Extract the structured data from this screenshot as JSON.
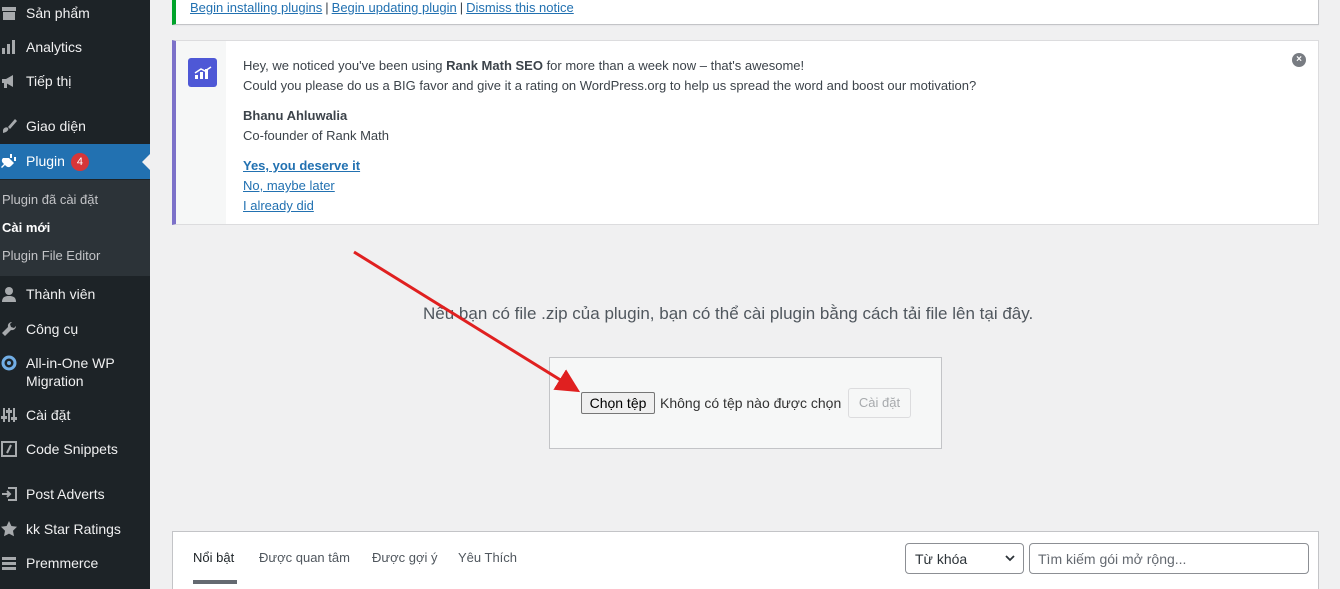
{
  "sidebar": {
    "items": [
      {
        "label": "Sản phẩm",
        "icon": "archive-icon"
      },
      {
        "label": "Analytics",
        "icon": "chart-bar-icon"
      },
      {
        "label": "Tiếp thị",
        "icon": "megaphone-icon"
      },
      {
        "label": "Giao diện",
        "icon": "paintbrush-icon"
      },
      {
        "label": "Plugin",
        "icon": "plug-icon",
        "badge": "4"
      },
      {
        "label": "Thành viên",
        "icon": "user-icon"
      },
      {
        "label": "Công cụ",
        "icon": "wrench-icon"
      },
      {
        "label": "All-in-One WP",
        "label2": "Migration",
        "icon": "migration-icon"
      },
      {
        "label": "Cài đặt",
        "icon": "settings-sliders-icon"
      },
      {
        "label": "Code Snippets",
        "icon": "code-icon"
      },
      {
        "label": "Post Adverts",
        "icon": "signin-icon"
      },
      {
        "label": "kk Star Ratings",
        "icon": "star-icon"
      },
      {
        "label": "Premmerce",
        "icon": "list-icon"
      }
    ],
    "submenu": [
      "Plugin đã cài đặt",
      "Cài mới",
      "Plugin File Editor"
    ]
  },
  "top_notice": {
    "links": [
      "Begin installing plugins",
      "Begin updating plugin",
      "Dismiss this notice"
    ],
    "separator": "|"
  },
  "rankmath_notice": {
    "line1_pre": "Hey, we noticed you've been using ",
    "line1_bold": "Rank Math SEO",
    "line1_post": " for more than a week now – that's awesome!",
    "line2": "Could you please do us a BIG favor and give it a rating on WordPress.org to help us spread the word and boost our motivation?",
    "author_name": "Bhanu Ahluwalia",
    "author_title": "Co-founder of Rank Math",
    "links": [
      "Yes, you deserve it",
      "No, maybe later",
      "I already did"
    ],
    "close_glyph": "×"
  },
  "upload": {
    "description": "Nếu bạn có file .zip của plugin, bạn có thể cài plugin bằng cách tải file lên tại đây.",
    "choose_file": "Chọn tệp",
    "no_file": "Không có tệp nào được chọn",
    "install": "Cài đặt"
  },
  "filter_bar": {
    "tabs": [
      "Nổi bật",
      "Được quan tâm",
      "Được gợi ý",
      "Yêu Thích"
    ],
    "select_value": "Từ khóa",
    "search_placeholder": "Tìm kiếm gói mở rộng..."
  },
  "colors": {
    "sidebar_bg": "#1d2327",
    "active_menu": "#2271b1",
    "badge": "#d63638",
    "notice_success": "#00a32a",
    "rankmath_accent": "#7c71c9",
    "arrow": "#e02020"
  }
}
